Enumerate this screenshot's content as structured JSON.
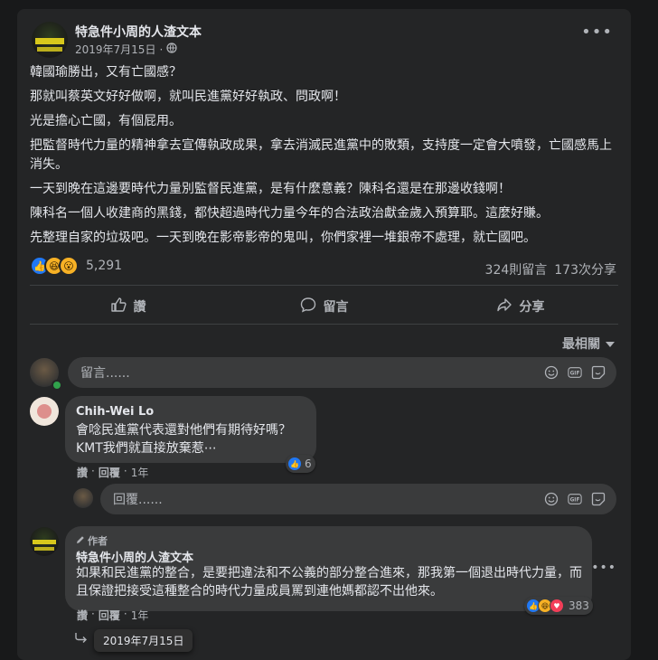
{
  "post": {
    "page_name": "特急件小周的人渣文本",
    "date": "2019年7月15日",
    "privacy_icon": "globe-icon",
    "paragraphs": [
      "韓國瑜勝出，又有亡國感？",
      "那就叫蔡英文好好做啊，就叫民進黨好好執政、問政啊！",
      "光是擔心亡國，有個屁用。",
      "把監督時代力量的精神拿去宣傳執政成果，拿去消滅民進黨中的敗類，支持度一定會大噴發，亡國感馬上消失。",
      "一天到晚在這邊要時代力量別監督民進黨，是有什麼意義？陳科名還是在那邊收錢啊！",
      "陳科名一個人收建商的黑錢，都快超過時代力量今年的合法政治獻金歲入預算耶。這麼好賺。",
      "先整理自家的垃圾吧。一天到晚在影帝影帝的鬼叫，你們家裡一堆銀帝不處理，就亡國吧。"
    ],
    "reaction_count": "5,291",
    "comment_count": "324則留言",
    "share_count": "173次分享"
  },
  "actions": {
    "like": "讚",
    "comment": "留言",
    "share": "分享"
  },
  "sort_label": "最相關",
  "composer": {
    "placeholder": "留言......"
  },
  "comments": [
    {
      "author": "Chih-Wei Lo",
      "lines": [
        "會唸民進黨代表還對他們有期待好嗎？",
        "KMT我們就直接放棄惹⋯"
      ],
      "like_label": "讚",
      "reply_label": "回覆",
      "time": "1年",
      "reaction_count": "6"
    }
  ],
  "reply_composer": {
    "placeholder": "回覆......"
  },
  "author_reply": {
    "badge": "作者",
    "author": "特急件小周的人渣文本",
    "text": "如果和民進黨的整合，是要把違法和不公義的部分整合進來，那我第一個退出時代力量，而且保證把接受這種整合的時代力量成員罵到連他媽都認不出他來。",
    "like_label": "讚",
    "reply_label": "回覆",
    "time": "1年",
    "reaction_count": "383"
  },
  "tooltip": "2019年7月15日",
  "colors": {
    "accent": "#2078f4",
    "card": "#242526",
    "bubble": "#3a3b3c"
  }
}
